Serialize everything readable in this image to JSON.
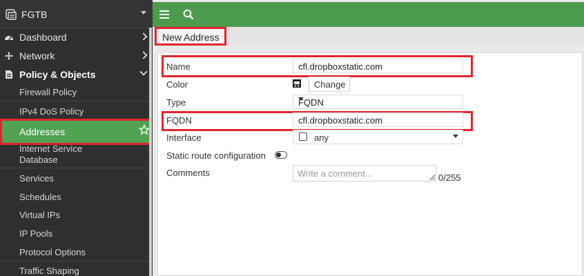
{
  "sidebar": {
    "device": "FGTB",
    "items": [
      {
        "label": "Dashboard"
      },
      {
        "label": "Network"
      },
      {
        "label": "Policy & Objects"
      }
    ],
    "sub_items": [
      {
        "label": "Firewall Policy"
      },
      {
        "label": "IPv4 DoS Policy"
      },
      {
        "label": "Addresses"
      },
      {
        "label": "Internet Service Database"
      },
      {
        "label": "Services"
      },
      {
        "label": "Schedules"
      },
      {
        "label": "Virtual IPs"
      },
      {
        "label": "IP Pools"
      },
      {
        "label": "Protocol Options"
      },
      {
        "label": "Traffic Shaping"
      }
    ]
  },
  "breadcrumb": {
    "title": "New Address"
  },
  "form": {
    "name": {
      "label": "Name",
      "value": "cfl.dropboxstatic.com"
    },
    "color": {
      "label": "Color",
      "button": "Change"
    },
    "type": {
      "label": "Type",
      "value": "FQDN"
    },
    "fqdn": {
      "label": "FQDN",
      "value": "cfl.dropboxstatic.com"
    },
    "interface": {
      "label": "Interface",
      "value": "any"
    },
    "static_route": {
      "label": "Static route configuration"
    },
    "comments": {
      "label": "Comments",
      "placeholder": "Write a comment...",
      "counter": "0/255"
    }
  },
  "colors": {
    "accent": "#4c9a4e",
    "highlight": "#e3242b",
    "sidebar_bg": "#2f2f2f"
  },
  "icons": [
    "device-icon",
    "dashboard-icon",
    "network-icon",
    "policy-icon",
    "star-icon",
    "menu-icon",
    "search-icon",
    "color-swatch-icon",
    "toggle-icon"
  ]
}
